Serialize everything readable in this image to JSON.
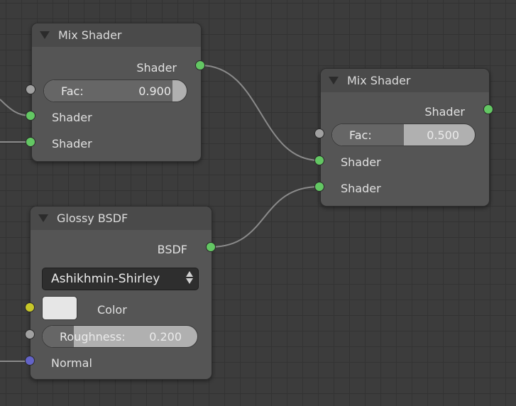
{
  "nodes": {
    "mix_shader_1": {
      "title": "Mix Shader",
      "output_label": "Shader",
      "fac_label": "Fac:",
      "fac_value": "0.900",
      "fac_fraction": 0.9,
      "input_shader_1": "Shader",
      "input_shader_2": "Shader"
    },
    "mix_shader_2": {
      "title": "Mix Shader",
      "output_label": "Shader",
      "fac_label": "Fac:",
      "fac_value": "0.500",
      "fac_fraction": 0.5,
      "input_shader_1": "Shader",
      "input_shader_2": "Shader"
    },
    "glossy_bsdf": {
      "title": "Glossy BSDF",
      "output_label": "BSDF",
      "distribution": "Ashikhmin-Shirley",
      "color_label": "Color",
      "color_value": "#e6e6e6",
      "roughness_label": "Roughness:",
      "roughness_value": "0.200",
      "roughness_fraction": 0.2,
      "normal_label": "Normal"
    }
  },
  "colors": {
    "background": "#3c3c3c",
    "node_body": "#555555",
    "node_header": "#4a4a4a",
    "shader_socket": "#63c763",
    "value_socket": "#a1a1a1",
    "color_socket": "#c7c729",
    "vector_socket": "#6363c7",
    "wire": "#8a8a8a"
  },
  "icons": {
    "collapse": "triangle-down-icon",
    "socket": "circle",
    "dropdown": "up-down-arrows-icon"
  }
}
